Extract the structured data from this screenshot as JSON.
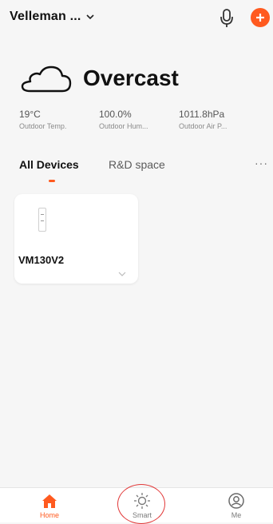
{
  "header": {
    "home_name": "Velleman ...",
    "mic_icon": "microphone-icon",
    "add_icon": "plus-circle-icon",
    "accent_color": "#ff5a1f"
  },
  "weather": {
    "icon": "cloud-icon",
    "condition": "Overcast",
    "stats": [
      {
        "value": "19°C",
        "label": "Outdoor Temp."
      },
      {
        "value": "100.0%",
        "label": "Outdoor Hum..."
      },
      {
        "value": "1011.8hPa",
        "label": "Outdoor Air P..."
      }
    ]
  },
  "tabs": {
    "items": [
      {
        "label": "All Devices",
        "active": true
      },
      {
        "label": "R&D space",
        "active": false
      }
    ],
    "more": "···"
  },
  "devices": [
    {
      "name": "VM130V2",
      "icon": "device-switch-icon"
    }
  ],
  "bottom_nav": {
    "items": [
      {
        "label": "Home",
        "icon": "home-icon",
        "active": true
      },
      {
        "label": "Smart",
        "icon": "sun-icon",
        "active": false
      },
      {
        "label": "Me",
        "icon": "user-icon",
        "active": false
      }
    ]
  }
}
